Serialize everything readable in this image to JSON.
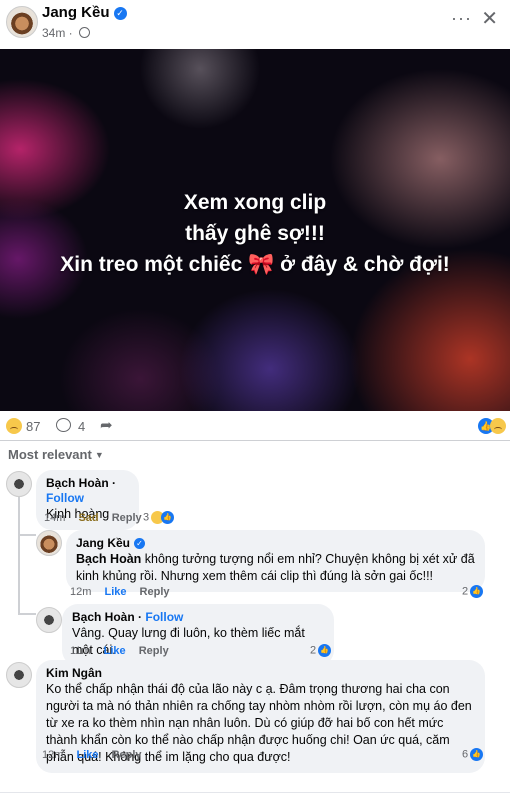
{
  "post": {
    "author": "Jang Kều",
    "time": "34m",
    "image_lines": [
      "Xem xong clip",
      "thấy ghê sợ!!!",
      "Xin treo một chiếc",
      "ở đây & chờ đợi!"
    ],
    "image_emoji": "🎀",
    "reaction_count": "87",
    "comment_count": "4"
  },
  "filter": {
    "label": "Most relevant"
  },
  "comments": [
    {
      "author": "Bạch Hoàn",
      "follow": "Follow",
      "text": "Kinh hoàng",
      "time": "14m",
      "reaction_action": "Sad",
      "reply": "Reply",
      "reaction_count": "3"
    },
    {
      "author": "Jang Kều",
      "mention": "Bạch Hoàn",
      "text": "không tưởng tượng nổi em nhỉ? Chuyện không bị xét xử đã kinh khủng rồi. Nhưng xem thêm cái clip thì đúng là sởn gai ốc!!!",
      "time": "12m",
      "like": "Like",
      "reply": "Reply",
      "reaction_count": "2"
    },
    {
      "author": "Bạch Hoàn",
      "follow": "Follow",
      "text": "Vâng. Quay lưng đi luôn, ko thèm liếc mắt một cái.",
      "time": "11m",
      "like": "Like",
      "reply": "Reply",
      "reaction_count": "2"
    },
    {
      "author": "Kim Ngân",
      "text": "Ko thể chấp nhận thái độ của lão này c ạ. Đâm trọng thương hai cha con người ta mà nó thản nhiên ra chống tay nhòm nhòm rồi lượn, còn mụ áo đen từ xe ra ko thèm nhìn nạn nhân luôn. Dù có giúp đỡ hai bố con hết mức thành khẩn còn ko thể nào chấp nhận được huống chi! Oan ức quá, căm phẫn quá! Không thể im lặng cho qua được!",
      "time": "12m",
      "like": "Like",
      "reply": "Reply",
      "reaction_count": "6"
    }
  ]
}
